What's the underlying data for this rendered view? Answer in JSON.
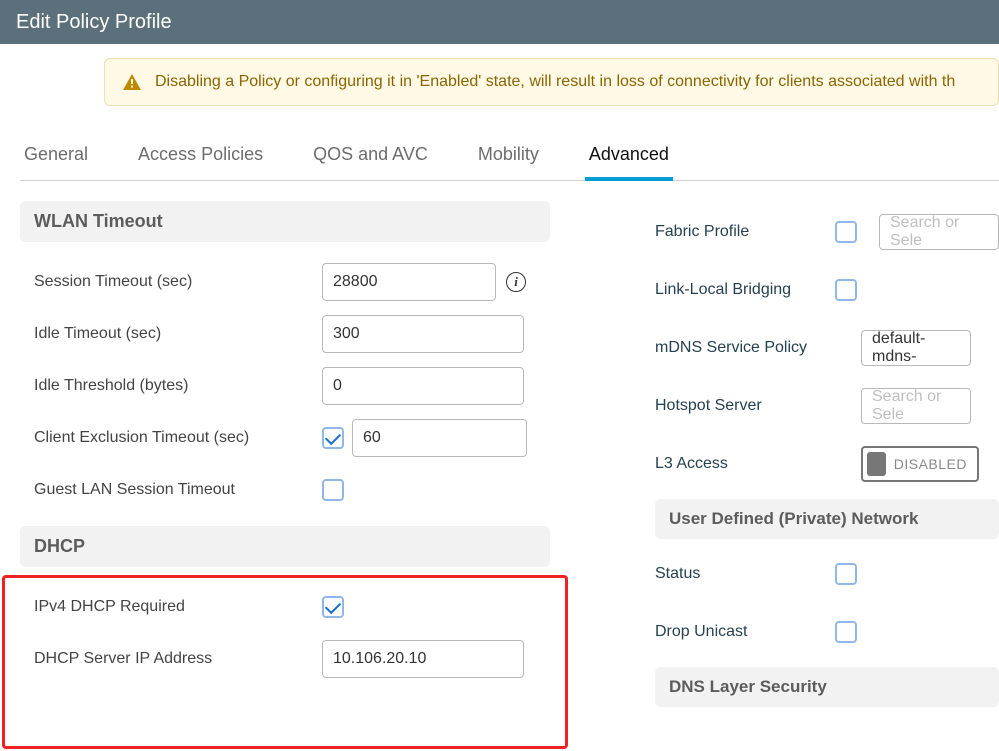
{
  "title": "Edit Policy Profile",
  "warning": "Disabling a Policy or configuring it in 'Enabled' state, will result in loss of connectivity for clients associated with th",
  "tabs": {
    "general": "General",
    "access": "Access Policies",
    "qos": "QOS and AVC",
    "mobility": "Mobility",
    "advanced": "Advanced"
  },
  "wlan_timeout": {
    "header": "WLAN Timeout",
    "session_timeout_label": "Session Timeout (sec)",
    "session_timeout_value": "28800",
    "idle_timeout_label": "Idle Timeout (sec)",
    "idle_timeout_value": "300",
    "idle_threshold_label": "Idle Threshold (bytes)",
    "idle_threshold_value": "0",
    "client_exclusion_label": "Client Exclusion Timeout (sec)",
    "client_exclusion_value": "60",
    "guest_lan_label": "Guest LAN Session Timeout"
  },
  "dhcp": {
    "header": "DHCP",
    "ipv4_required_label": "IPv4 DHCP Required",
    "server_ip_label": "DHCP Server IP Address",
    "server_ip_value": "10.106.20.10"
  },
  "right": {
    "fabric_profile_label": "Fabric Profile",
    "fabric_profile_placeholder": "Search or Sele",
    "link_local_label": "Link-Local Bridging",
    "mdns_label": "mDNS Service Policy",
    "mdns_value": "default-mdns-",
    "hotspot_label": "Hotspot Server",
    "hotspot_placeholder": "Search or Sele",
    "l3_label": "L3 Access",
    "l3_value": "DISABLED",
    "udn_header": "User Defined (Private) Network",
    "status_label": "Status",
    "drop_unicast_label": "Drop Unicast",
    "dns_header": "DNS Layer Security"
  }
}
